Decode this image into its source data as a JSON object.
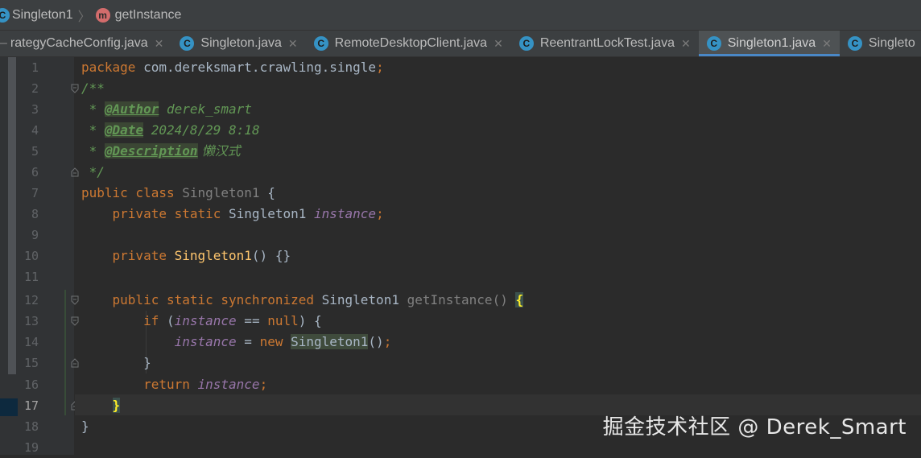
{
  "breadcrumb": {
    "class_name": "Singleton1",
    "method_name": "getInstance",
    "class_icon": "class-icon",
    "method_icon": "method-icon"
  },
  "tabs": [
    {
      "label": "rategyCacheConfig.java",
      "active": false,
      "icon": "none"
    },
    {
      "label": "Singleton.java",
      "active": false,
      "icon": "class-icon"
    },
    {
      "label": "RemoteDesktopClient.java",
      "active": false,
      "icon": "class-icon"
    },
    {
      "label": "ReentrantLockTest.java",
      "active": false,
      "icon": "class-icon"
    },
    {
      "label": "Singleton1.java",
      "active": true,
      "icon": "class-icon"
    },
    {
      "label": "Singleto",
      "active": false,
      "icon": "class-icon"
    }
  ],
  "editor": {
    "line_numbers": [
      "1",
      "2",
      "3",
      "4",
      "5",
      "6",
      "7",
      "8",
      "9",
      "10",
      "11",
      "12",
      "13",
      "14",
      "15",
      "16",
      "17",
      "18",
      "19"
    ],
    "current_line": "17",
    "code": {
      "l1_kw": "package",
      "l1_rest": " com.dereksmart.crawling.single",
      "l1_semi": ";",
      "l2": "/**",
      "l3_star": " * ",
      "l3_tag": "@Author",
      "l3_val": " derek_smart",
      "l4_star": " * ",
      "l4_tag": "@Date",
      "l4_val": " 2024/8/29 8:18",
      "l5_star": " * ",
      "l5_tag": "@Description",
      "l5_val": " 懒汉式",
      "l6": " */",
      "l7_kw": "public class ",
      "l7_cls": "Singleton1",
      "l7_rest": " {",
      "l8_kw": "    private static ",
      "l8_type": "Singleton1 ",
      "l8_field": "instance",
      "l8_semi": ";",
      "l10_kw": "    private ",
      "l10_ctor": "Singleton1",
      "l10_rest": "() {}",
      "l12_kw": "    public static synchronized ",
      "l12_type": "Singleton1 ",
      "l12_meth": "getInstance",
      "l12_paren": "()",
      "l12_space": " ",
      "l12_brace": "{",
      "l13_kw": "        if ",
      "l13_p1": "(",
      "l13_field": "instance",
      "l13_op": " == ",
      "l13_null": "null",
      "l13_p2": ") {",
      "l14_indent": "            ",
      "l14_field": "instance",
      "l14_op": " = ",
      "l14_new": "new ",
      "l14_cls": "Singleton1",
      "l14_rest": "()",
      "l14_semi": ";",
      "l15": "        }",
      "l16_kw": "        return ",
      "l16_field": "instance",
      "l16_semi": ";",
      "l17_indent": "    ",
      "l17_brace": "}",
      "l18": "}"
    }
  },
  "watermark": "掘金技术社区 @ Derek_Smart",
  "colors": {
    "background": "#2b2b2b",
    "keyword": "#cc7832",
    "comment": "#629755",
    "field": "#9876aa",
    "active_tab_underline": "#4a88c7"
  }
}
